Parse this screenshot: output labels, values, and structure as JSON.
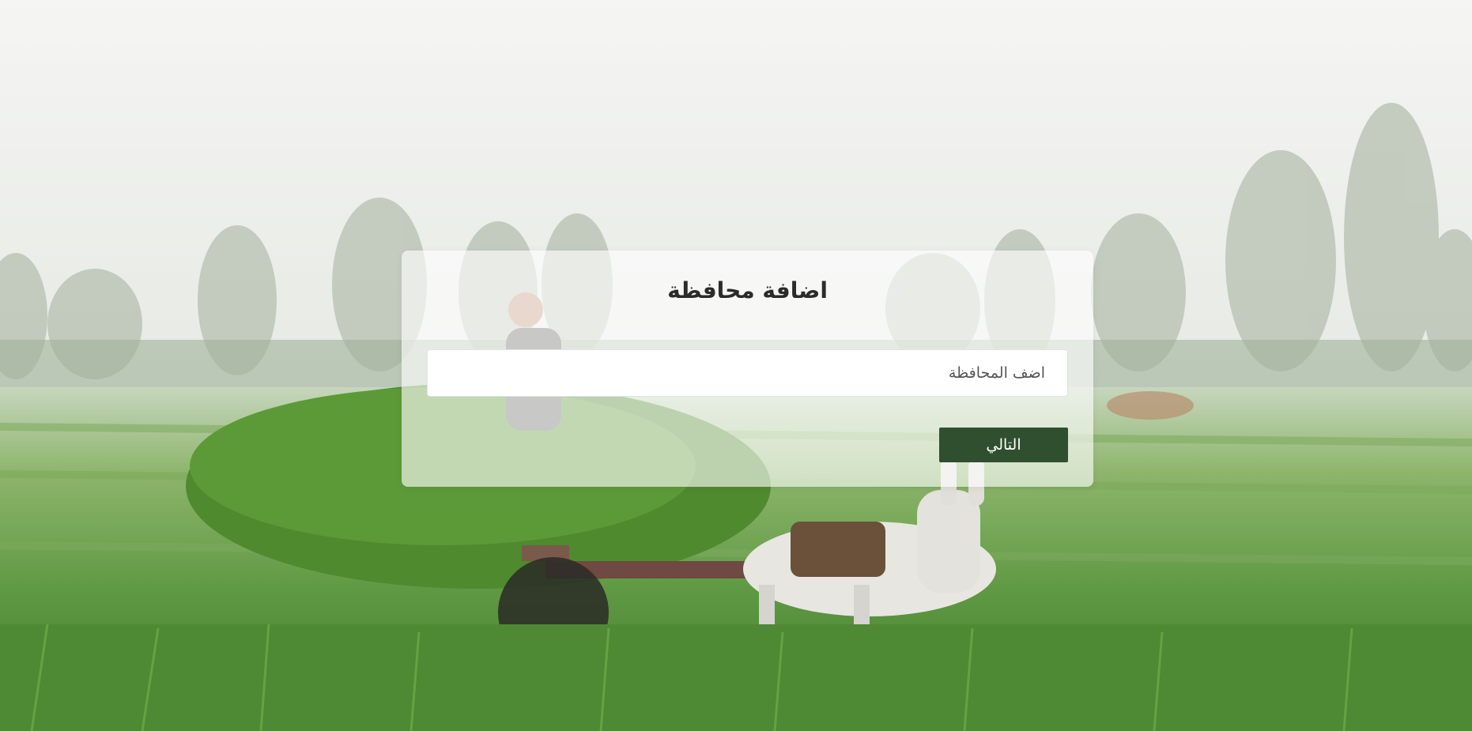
{
  "form": {
    "title": "اضافة محافظة",
    "input": {
      "value": "",
      "placeholder": "اضف المحافظة"
    },
    "next_label": "التالي"
  },
  "colors": {
    "button_bg": "#2f4f2f",
    "button_text": "#ffffff",
    "card_bg": "rgba(255,255,255,0.62)",
    "title_text": "#2b2b2b"
  }
}
